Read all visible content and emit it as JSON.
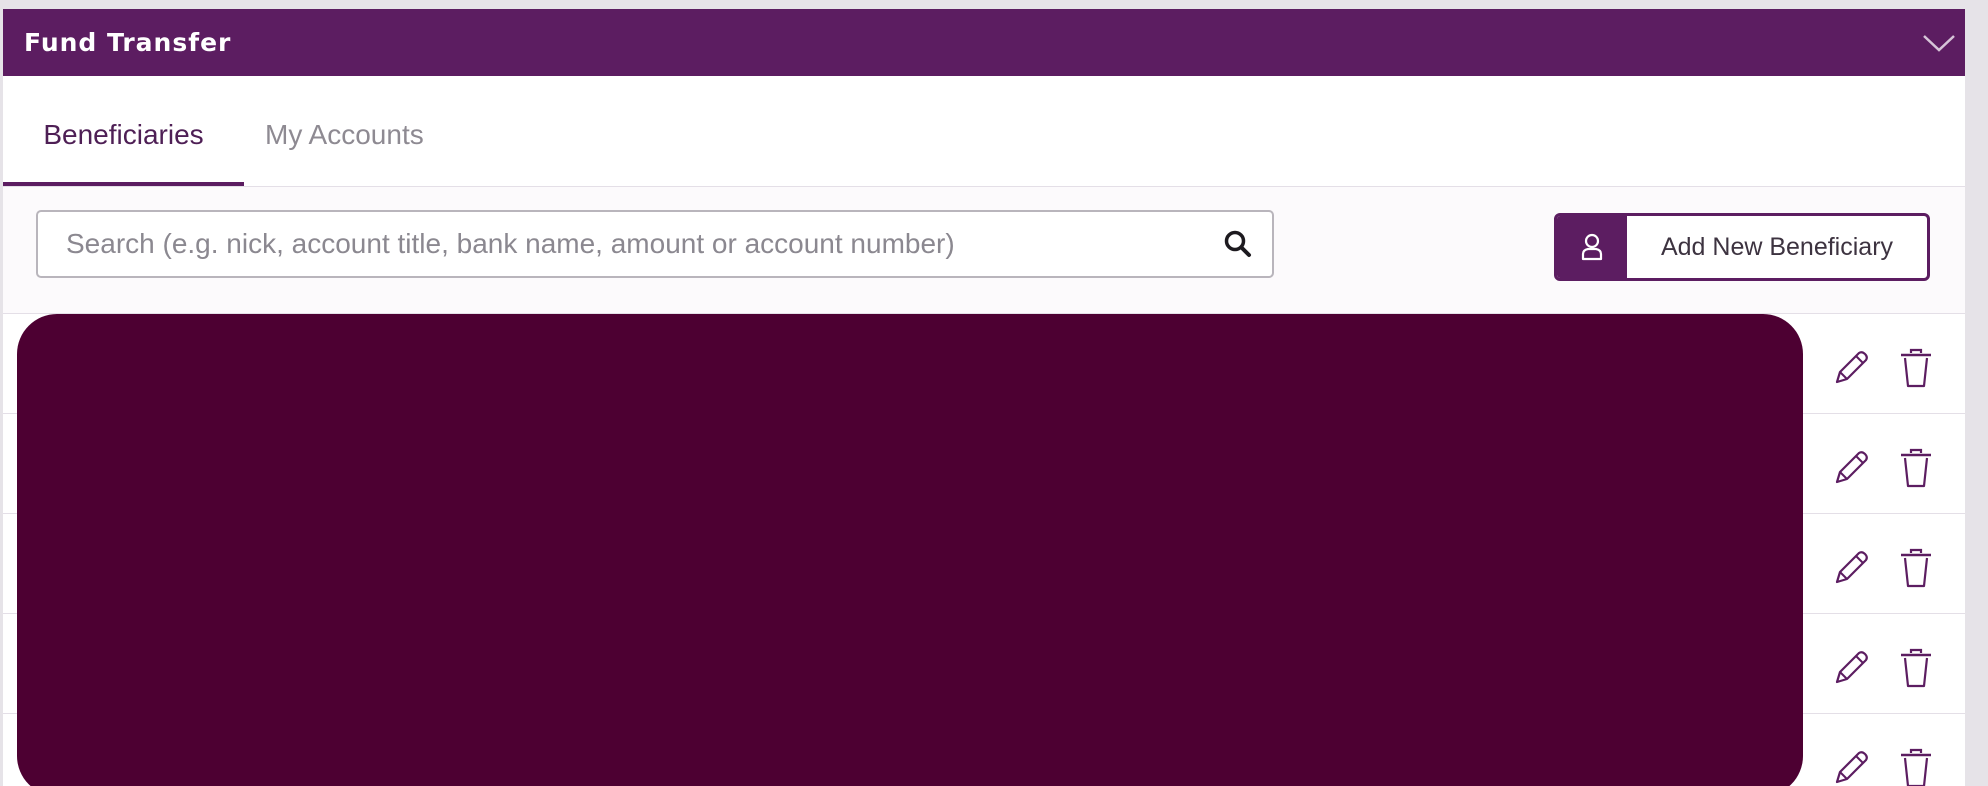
{
  "header": {
    "title": "Fund Transfer",
    "collapse_icon": "chevron-down-icon"
  },
  "tabs": [
    {
      "label": "Beneficiaries",
      "active": true
    },
    {
      "label": "My Accounts",
      "active": false
    }
  ],
  "search": {
    "placeholder": "Search (e.g. nick, account title, bank name, amount or account number)",
    "value": "",
    "icon": "search-icon"
  },
  "add_beneficiary": {
    "label": "Add New Beneficiary",
    "icon": "user-icon"
  },
  "rows": [
    {
      "actions": [
        "edit-icon",
        "delete-icon"
      ]
    },
    {
      "actions": [
        "edit-icon",
        "delete-icon"
      ]
    },
    {
      "actions": [
        "edit-icon",
        "delete-icon"
      ]
    },
    {
      "actions": [
        "edit-icon",
        "delete-icon"
      ]
    },
    {
      "actions": [
        "edit-icon",
        "delete-icon"
      ]
    }
  ],
  "colors": {
    "brand": "#5c1d61",
    "redaction": "#4d0032",
    "inactive_tab": "#8e8a92",
    "icon_stroke": "#5c1d61"
  }
}
